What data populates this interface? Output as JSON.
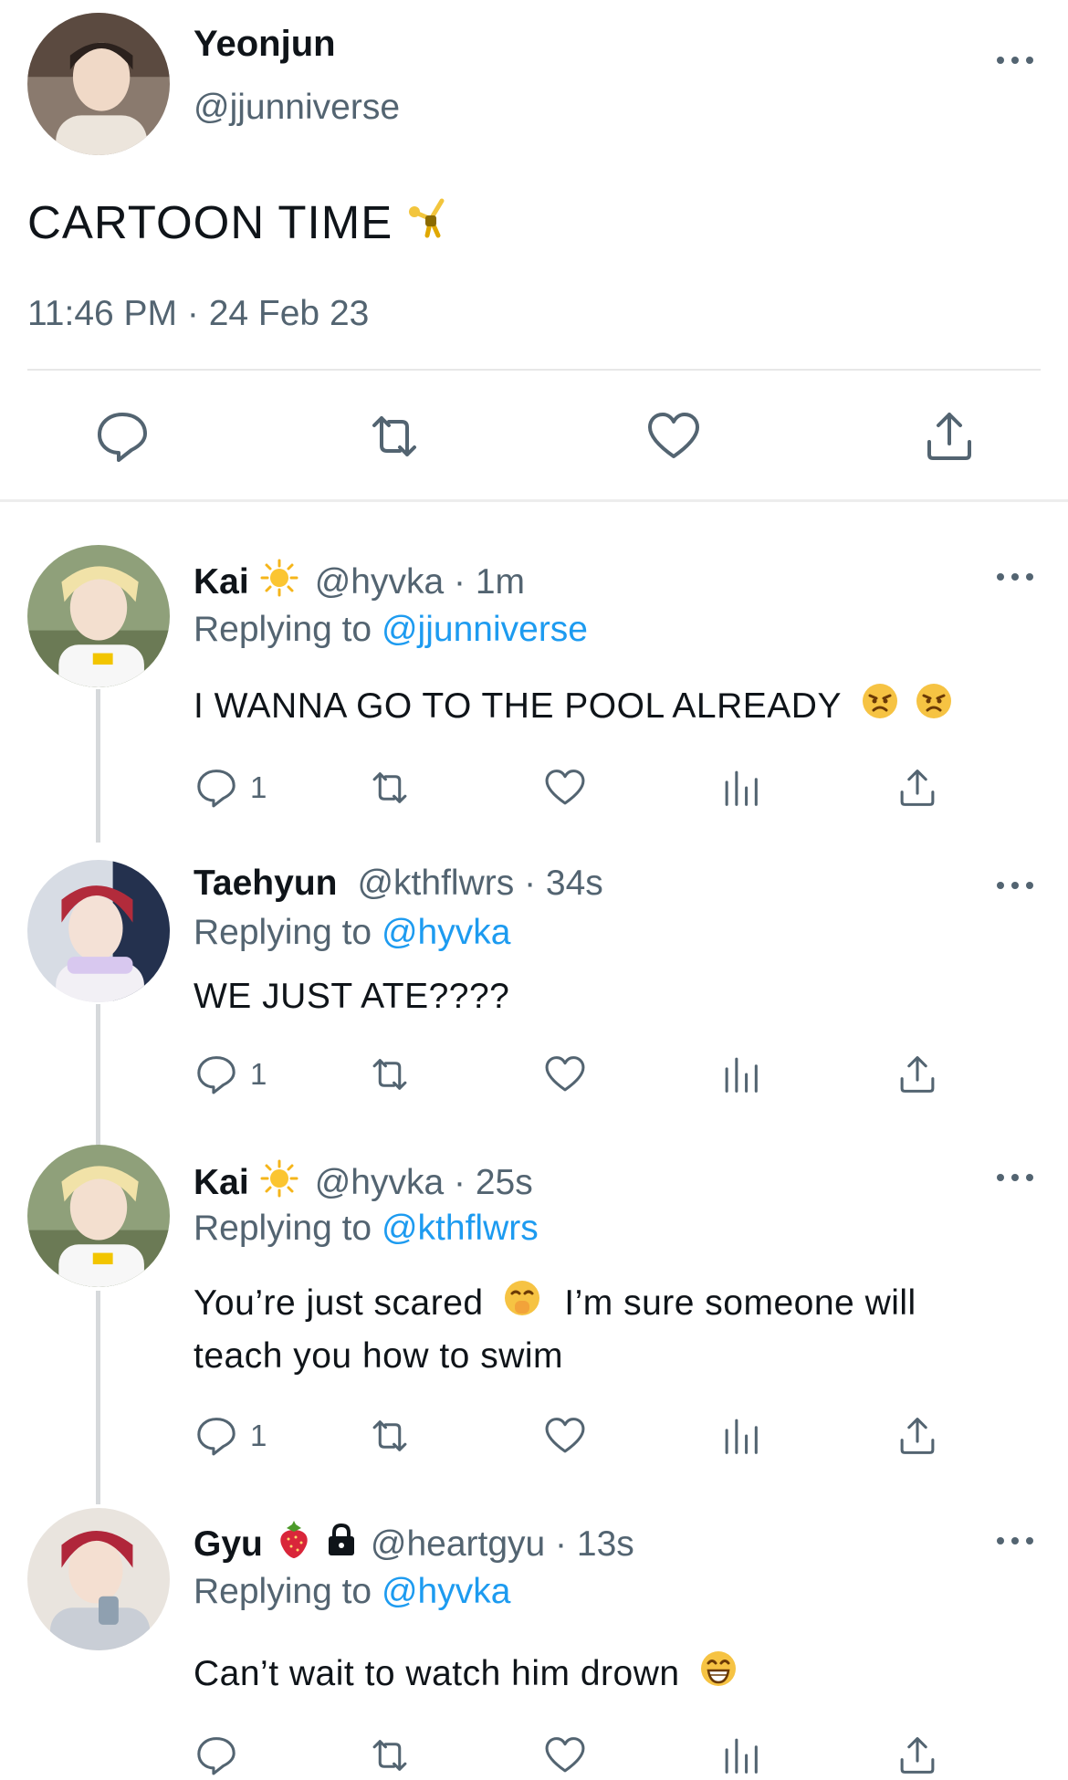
{
  "main_tweet": {
    "author_name": "Yeonjun",
    "author_handle": "@jjunniverse",
    "text": "CARTOON TIME",
    "text_emoji": "cartwheel-emoji",
    "timestamp": "11:46 PM · 24 Feb 23",
    "actions": [
      "reply-icon",
      "retweet-icon",
      "like-icon",
      "share-icon"
    ]
  },
  "replies": [
    {
      "name": "Kai",
      "badge": "sun-emoji",
      "handle_time": "@hyvka · 1m",
      "replying_prefix": "Replying to",
      "replying_to": "@jjunniverse",
      "text": "I WANNA GO TO THE POOL ALREADY",
      "text_emojis": [
        "angry-face-emoji",
        "angry-face-emoji"
      ],
      "reply_count": "1"
    },
    {
      "name": "Taehyun",
      "handle_time": "@kthflwrs · 34s",
      "replying_prefix": "Replying to",
      "replying_to": "@hyvka",
      "text": "WE JUST ATE????",
      "reply_count": "1"
    },
    {
      "name": "Kai",
      "badge": "sun-emoji",
      "handle_time": "@hyvka · 25s",
      "replying_prefix": "Replying to",
      "replying_to": "@kthflwrs",
      "text_line1_a": "You’re just scared",
      "text_emoji": "hand-over-mouth-emoji",
      "text_line1_b": "I’m sure someone will",
      "text_line2": "teach you how to swim",
      "reply_count": "1"
    },
    {
      "name": "Gyu",
      "badge": "strawberry-emoji",
      "locked_icon": "lock-icon",
      "handle_time": "@heartgyu · 13s",
      "replying_prefix": "Replying to",
      "replying_to": "@hyvka",
      "text": "Can’t wait to watch him drown",
      "text_emoji": "grinning-face-emoji",
      "reply_count": ""
    }
  ],
  "colors": {
    "text_primary": "#0f1419",
    "text_secondary": "#536471",
    "link": "#1d9bf0",
    "divider": "#e7e7e7",
    "thread_line": "#d6d9db"
  }
}
